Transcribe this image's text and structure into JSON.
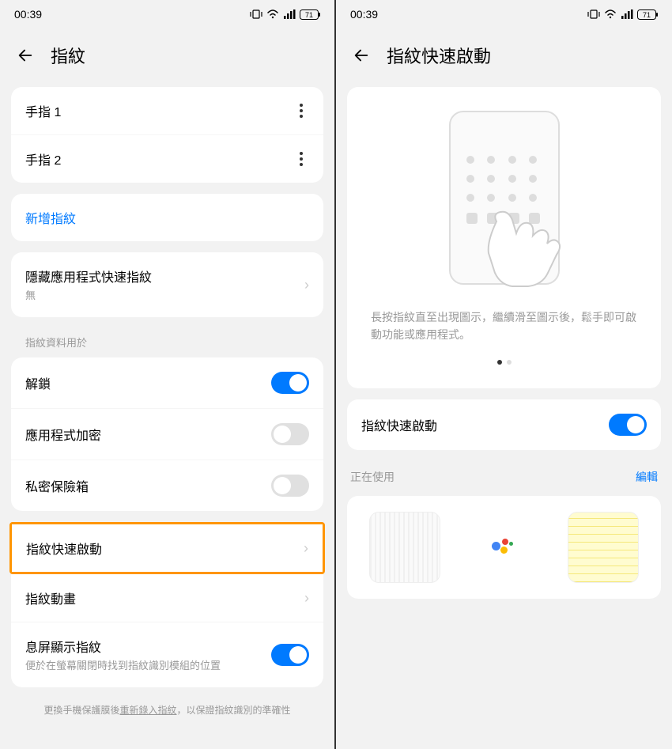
{
  "status": {
    "time": "00:39",
    "battery": "71"
  },
  "left": {
    "title": "指紋",
    "fingers": [
      "手指 1",
      "手指 2"
    ],
    "add": "新增指紋",
    "hidden_app": {
      "title": "隱藏應用程式快速指紋",
      "subtitle": "無"
    },
    "section_label": "指紋資料用於",
    "unlock": "解鎖",
    "app_encrypt": "應用程式加密",
    "private_safe": "私密保險箱",
    "quick_launch": "指紋快速啟動",
    "animation": "指紋動畫",
    "aod": {
      "title": "息屏顯示指紋",
      "subtitle": "便於在螢幕關閉時找到指紋識別模組的位置"
    },
    "footer_pre": "更換手機保護膜後",
    "footer_link": "重新錄入指紋",
    "footer_post": "，以保證指紋識別的準確性"
  },
  "right": {
    "title": "指紋快速啟動",
    "instruction": "長按指紋直至出現圖示，繼續滑至圖示後，鬆手即可啟動功能或應用程式。",
    "toggle_label": "指紋快速啟動",
    "in_use": "正在使用",
    "edit": "編輯"
  }
}
